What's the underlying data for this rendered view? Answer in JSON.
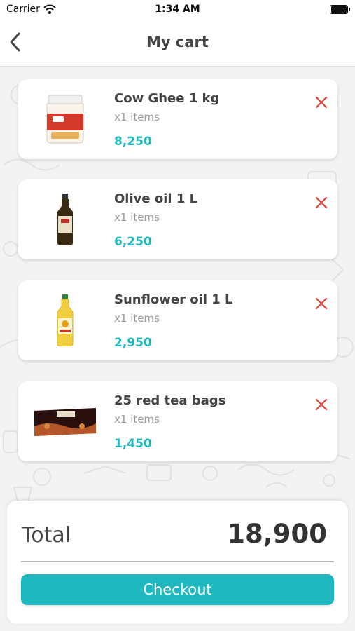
{
  "status_bar": {
    "carrier": "Carrier",
    "time": "1:34 AM"
  },
  "header": {
    "title": "My cart",
    "back_icon": "chevron-left-icon"
  },
  "cart": {
    "items": [
      {
        "name": "Cow Ghee 1 kg",
        "qty": "x1 items",
        "price": "8,250",
        "image": "ghee-jar-image"
      },
      {
        "name": "Olive oil 1 L",
        "qty": "x1 items",
        "price": "6,250",
        "image": "olive-oil-bottle-image"
      },
      {
        "name": "Sunflower oil 1 L",
        "qty": "x1 items",
        "price": "2,950",
        "image": "sunflower-oil-bottle-image"
      },
      {
        "name": "25 red tea bags",
        "qty": "x1 items",
        "price": "1,450",
        "image": "tea-box-image"
      }
    ]
  },
  "summary": {
    "total_label": "Total",
    "total_value": "18,900",
    "checkout_label": "Checkout"
  },
  "colors": {
    "accent": "#1fb8c1",
    "remove": "#e0433a",
    "text": "#444444"
  }
}
